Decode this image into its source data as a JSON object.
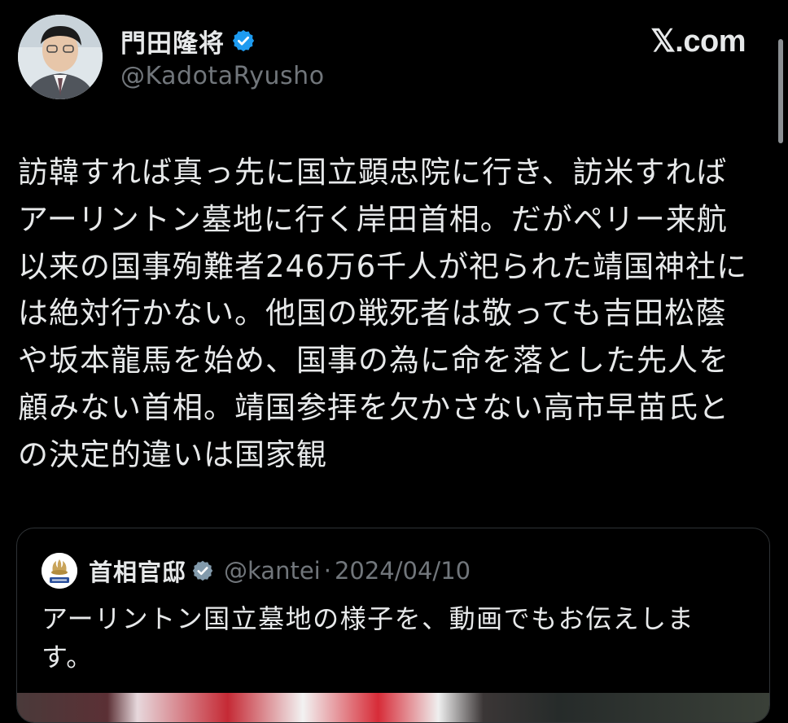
{
  "post": {
    "author": {
      "display_name": "門田隆将",
      "handle": "@KadotaRyusho",
      "verified": true
    },
    "brand": "𝕏.com",
    "text": "訪韓すれば真っ先に国立顕忠院に行き、訪米すればアーリントン墓地に行く岸田首相。だがペリー来航以来の国事殉難者246万6千人が祀られた靖国神社には絶対行かない。他国の戦死者は敬っても吉田松蔭や坂本龍馬を始め、国事の為に命を落とした先人を顧みない首相。靖国参拝を欠かさない高市早苗氏との決定的違いは国家観"
  },
  "quoted_post": {
    "author": {
      "display_name": "首相官邸",
      "handle": "@kantei",
      "verified": true
    },
    "separator": "·",
    "date": "2024/04/10",
    "text": "アーリントン国立墓地の様子を、動画でもお伝えします。"
  },
  "colors": {
    "background": "#000000",
    "text_primary": "#e7e9ea",
    "text_secondary": "#71767b",
    "verified_badge": "#1d9bf0",
    "card_border": "#2f3336"
  },
  "icons": {
    "verified": "verified-badge-icon",
    "avatar": "avatar",
    "quoted_avatar": "kantei-logo"
  }
}
